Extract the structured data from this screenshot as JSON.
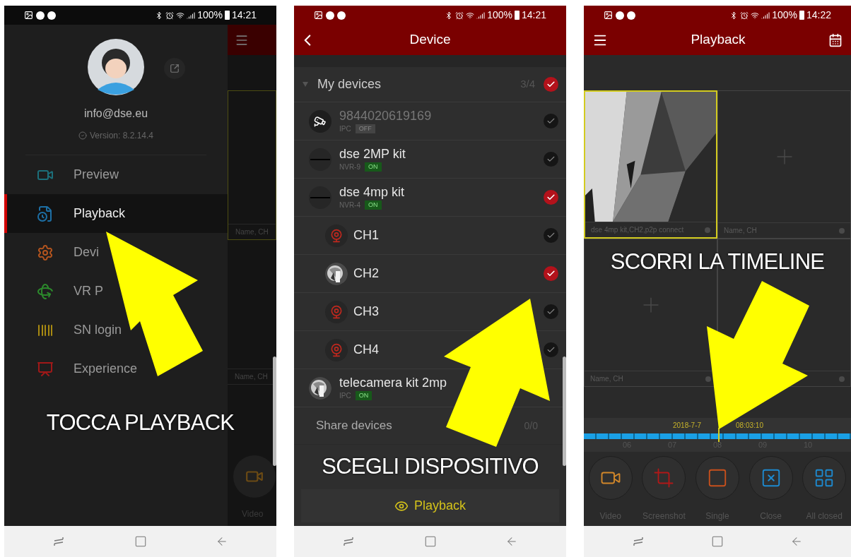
{
  "phones": [
    {
      "kind": "menu",
      "status": {
        "battery": "100%",
        "time": "14:21"
      },
      "account": {
        "email": "info@dse.eu",
        "version": "Version: 8.2.14.4"
      },
      "menu": [
        {
          "label": "Preview",
          "selected": false
        },
        {
          "label": "Playback",
          "selected": true
        },
        {
          "label": "Devi",
          "selected": false
        },
        {
          "label": "VR P",
          "selected": false
        },
        {
          "label": "SN login",
          "selected": false
        },
        {
          "label": "Experience",
          "selected": false
        }
      ],
      "behind": {
        "cells": [
          "Name, CH",
          "Name, CH"
        ],
        "button": "Video"
      },
      "caption": "TOCCA PLAYBACK"
    },
    {
      "kind": "devices",
      "status": {
        "battery": "100%",
        "time": "14:21"
      },
      "title": "Device",
      "group": {
        "label": "My devices",
        "count": "3/4",
        "selected": true,
        "expanded": true
      },
      "items": [
        {
          "kind": "ipc",
          "name": "9844020619169",
          "type": "IPC",
          "status": "OFF",
          "online": false,
          "selected": false
        },
        {
          "kind": "nvr",
          "name": "dse 2MP kit",
          "type": "NVR-9",
          "status": "ON",
          "online": true,
          "selected": false
        },
        {
          "kind": "nvr",
          "name": "dse 4mp kit",
          "type": "NVR-4",
          "status": "ON",
          "online": true,
          "selected": true
        },
        {
          "kind": "channel",
          "name": "CH1",
          "selected": false
        },
        {
          "kind": "channel",
          "name": "CH2",
          "thumbnail": true,
          "selected": true
        },
        {
          "kind": "channel",
          "name": "CH3",
          "selected": false
        },
        {
          "kind": "channel",
          "name": "CH4",
          "selected": false
        },
        {
          "kind": "ipc",
          "name": "telecamera kit 2mp",
          "type": "IPC",
          "status": "ON",
          "online": true,
          "thumbnail": true
        }
      ],
      "share": {
        "label": "Share devices",
        "count": "0/0"
      },
      "caption": "SCEGLI DISPOSITIVO",
      "button": "Playback"
    },
    {
      "kind": "playback",
      "status": {
        "battery": "100%",
        "time": "14:22"
      },
      "title": "Playback",
      "cells": [
        {
          "kind": "video",
          "label": "dse 4mp kit,CH2,p2p connect",
          "selected": true
        },
        {
          "kind": "empty",
          "label": "Name, CH",
          "selected": false
        },
        {
          "kind": "empty",
          "label": "Name, CH",
          "selected": false
        },
        {
          "kind": "hidden",
          "selected": false
        }
      ],
      "caption": "SCORRI LA TIMELINE",
      "timeline": {
        "date": "2018-7-7",
        "time": "08:03:10",
        "hours": [
          "06",
          "07",
          "08",
          "09",
          "10"
        ]
      },
      "toolbar": [
        {
          "label": "Video"
        },
        {
          "label": "Screenshot"
        },
        {
          "label": "Single"
        },
        {
          "label": "Close"
        },
        {
          "label": "All closed"
        }
      ]
    }
  ]
}
